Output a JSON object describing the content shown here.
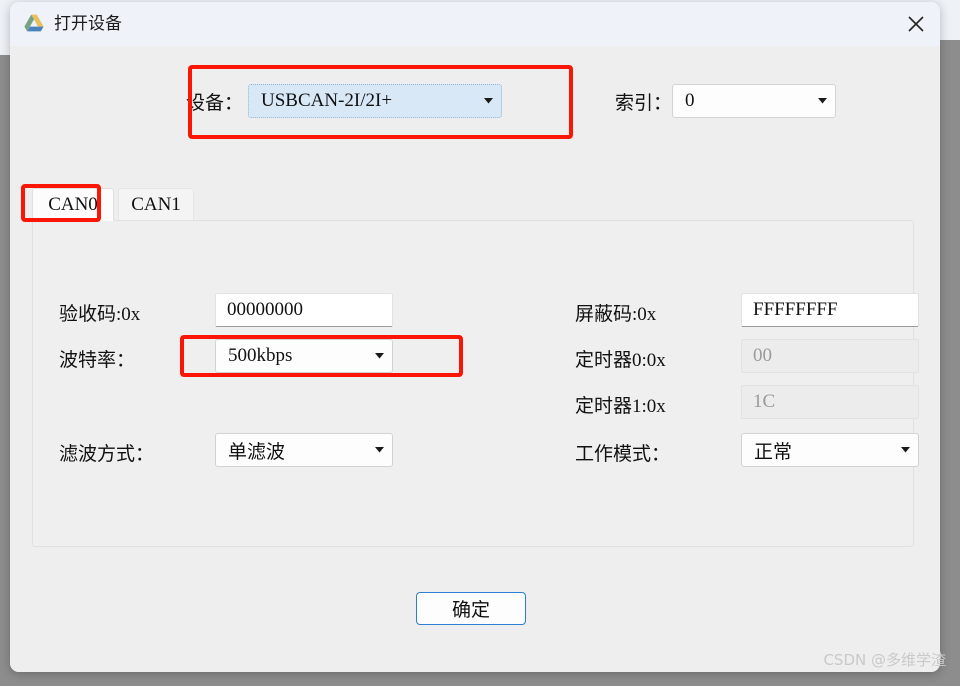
{
  "window": {
    "title": "打开设备",
    "icon": "drive-triangle-icon",
    "close_label": "×"
  },
  "device_row": {
    "device_label": "设备：",
    "device_value": "USBCAN-2I/2I+",
    "index_label": "索引：",
    "index_value": "0"
  },
  "tabs": [
    {
      "label": "CAN0",
      "active": true
    },
    {
      "label": "CAN1",
      "active": false
    }
  ],
  "form": {
    "left": [
      {
        "label": "验收码:0x",
        "value": "00000000",
        "type": "text",
        "disabled": false
      },
      {
        "label": "波特率：",
        "value": "500kbps",
        "type": "combo",
        "disabled": false
      },
      {
        "label": "滤波方式：",
        "value": "单滤波",
        "type": "combo",
        "disabled": false
      }
    ],
    "right": [
      {
        "label": "屏蔽码:0x",
        "value": "FFFFFFFF",
        "type": "text",
        "disabled": false
      },
      {
        "label": "定时器0:0x",
        "value": "00",
        "type": "text",
        "disabled": true
      },
      {
        "label": "定时器1:0x",
        "value": "1C",
        "type": "text",
        "disabled": true
      },
      {
        "label": "工作模式：",
        "value": "正常",
        "type": "combo",
        "disabled": false
      }
    ]
  },
  "footer": {
    "ok_label": "确定"
  },
  "watermark": {
    "text": "CSDN @多维学渣"
  },
  "annotations": {
    "color": "#fb1505",
    "boxes": [
      {
        "name": "device-highlight"
      },
      {
        "name": "can0-tab-highlight"
      },
      {
        "name": "baudrate-highlight"
      }
    ]
  }
}
